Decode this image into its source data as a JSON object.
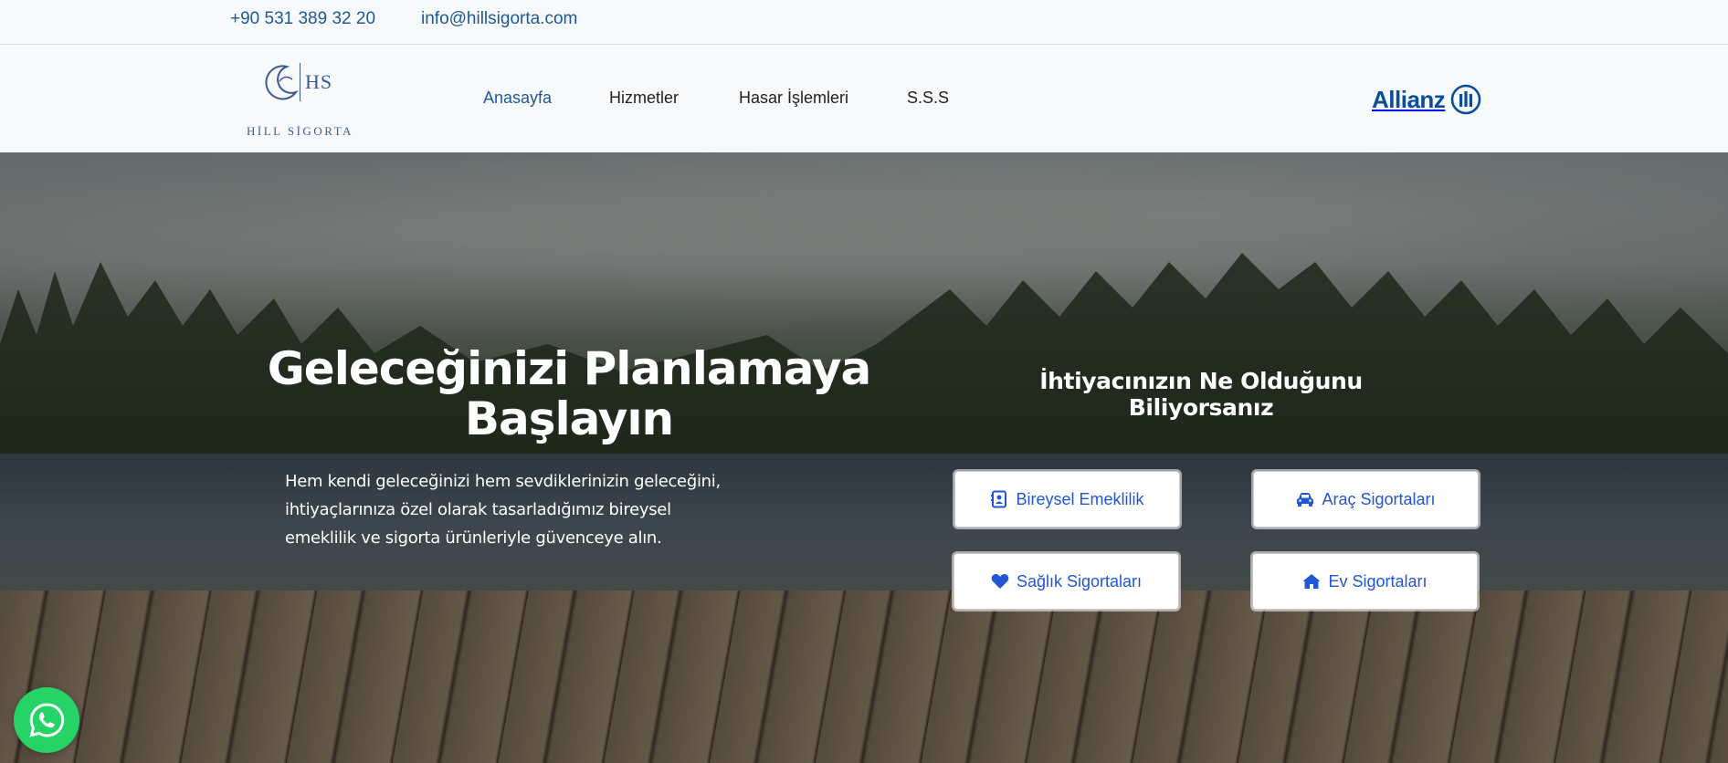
{
  "topbar": {
    "phone": "+90 531 389 32 20",
    "email": "info@hillsigorta.com"
  },
  "logo": {
    "mark": "HS",
    "name": "HİLL SİGORTA"
  },
  "nav": {
    "items": [
      {
        "label": "Anasayfa",
        "active": true
      },
      {
        "label": "Hizmetler",
        "active": false
      },
      {
        "label": "Hasar İşlemleri",
        "active": false
      },
      {
        "label": "S.S.S",
        "active": false
      }
    ],
    "partner_logo": "Allianz"
  },
  "hero": {
    "title": "Geleceğinizi Planlamaya Başlayın",
    "description": "Hem kendi geleceğinizi hem sevdiklerinizin geleceğini, ihtiyaçlarınıza özel olarak tasarladığımız bireysel emeklilik ve sigorta ürünleriyle güvenceye alın.",
    "question": "İhtiyacınızın Ne Olduğunu Biliyorsanız",
    "services": [
      {
        "label": "Bireysel Emeklilik",
        "icon": "address-book-icon"
      },
      {
        "label": "Araç Sigortaları",
        "icon": "car-icon"
      },
      {
        "label": "Sağlık Sigortaları",
        "icon": "heart-icon"
      },
      {
        "label": "Ev Sigortaları",
        "icon": "home-icon"
      }
    ]
  },
  "colors": {
    "link_blue": "#1a5a96",
    "button_text": "#2256d6",
    "allianz_blue": "#0a4d99",
    "whatsapp_green": "#25d366"
  },
  "floating": {
    "whatsapp_icon": "whatsapp-icon"
  }
}
